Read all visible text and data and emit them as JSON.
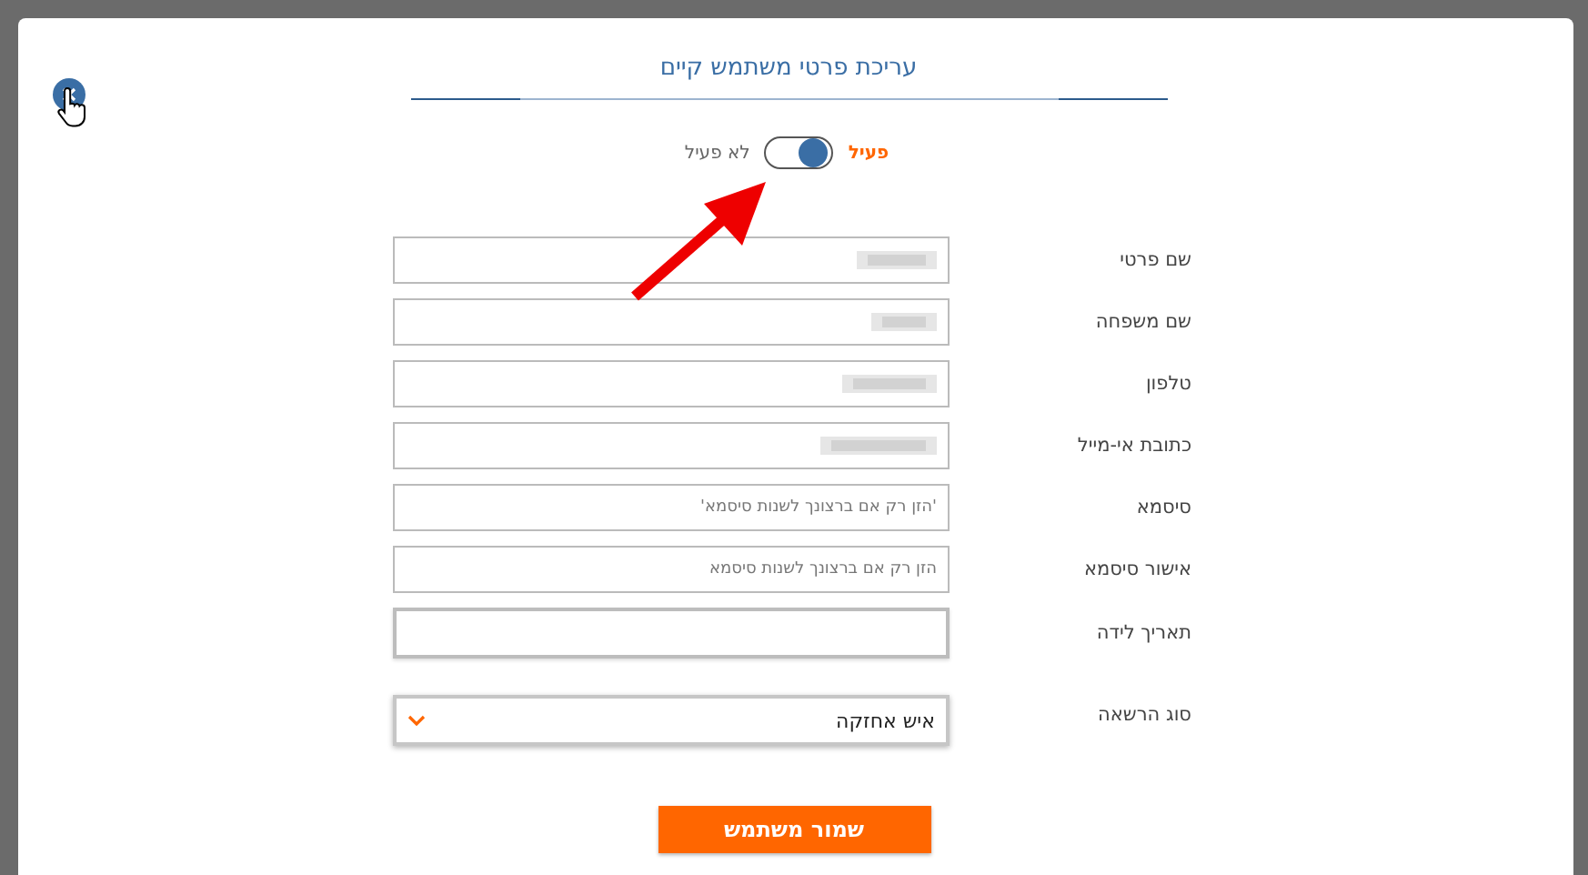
{
  "dialog": {
    "title": "עריכת פרטי משתמש קיים"
  },
  "status": {
    "active_label": "פעיל",
    "inactive_label": "לא פעיל",
    "on": true
  },
  "fields": [
    {
      "label": "שם פרטי",
      "kind": "text",
      "blurred": true
    },
    {
      "label": "שם משפחה",
      "kind": "text",
      "blurred": true
    },
    {
      "label": "טלפון",
      "kind": "text",
      "blurred": true
    },
    {
      "label": "כתובת אי-מייל",
      "kind": "text",
      "blurred": true
    },
    {
      "label": "סיסמא",
      "kind": "text",
      "placeholder": "'הזן רק אם ברצונך לשנות סיסמא'"
    },
    {
      "label": "אישור סיסמא",
      "kind": "text",
      "placeholder": "הזן רק אם ברצונך לשנות סיסמא"
    },
    {
      "label": "תאריך לידה",
      "kind": "date"
    },
    {
      "label": "סוג הרשאה",
      "kind": "select",
      "value": "איש אחזקה"
    }
  ],
  "save_button": {
    "label": "שמור משתמש"
  }
}
